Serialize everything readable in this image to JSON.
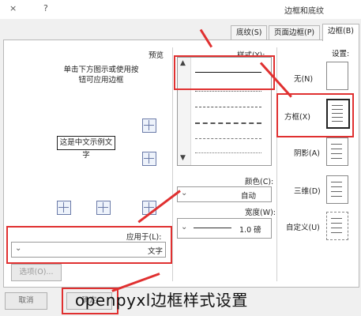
{
  "window": {
    "title": "边框和底纹",
    "help": "?",
    "close": "×"
  },
  "tabs": [
    {
      "label": "边框(B)",
      "active": true
    },
    {
      "label": "页面边框(P)",
      "active": false
    },
    {
      "label": "底纹(S)",
      "active": false
    }
  ],
  "settings": {
    "header": "设置:",
    "options": [
      "无(N)",
      "方框(X)",
      "阴影(A)",
      "三维(D)",
      "自定义(U)"
    ],
    "selected": "方框(X)"
  },
  "style": {
    "header": "样式(Y):",
    "color_label": "颜色(C):",
    "color_value": "自动",
    "width_label": "宽度(W):",
    "width_value": "1.0 磅"
  },
  "preview": {
    "header": "预览",
    "instruction": "单击下方图示或使用按钮可应用边框",
    "sample_text": "这是中文示例文字",
    "apply_to_label": "应用于(L):",
    "apply_to_value": "文字",
    "options_button": "选项(O)..."
  },
  "buttons": {
    "ok": "确定",
    "cancel": "取消"
  },
  "caption": "openpyxl边框样式设置",
  "colors": {
    "highlight": "#e03030"
  }
}
